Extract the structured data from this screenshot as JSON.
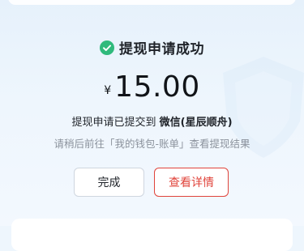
{
  "status": {
    "icon": "check-circle-icon",
    "title": "提现申请成功",
    "color": "#2fba7c"
  },
  "amount": {
    "currency": "¥",
    "value": "15.00"
  },
  "message": {
    "prefix": "提现申请已提交到",
    "target": "微信(星辰顺舟)"
  },
  "hint": "请稍后前往「我的钱包-账单」查看提现结果",
  "buttons": {
    "done_label": "完成",
    "detail_label": "查看详情",
    "detail_color": "#e0443b"
  }
}
